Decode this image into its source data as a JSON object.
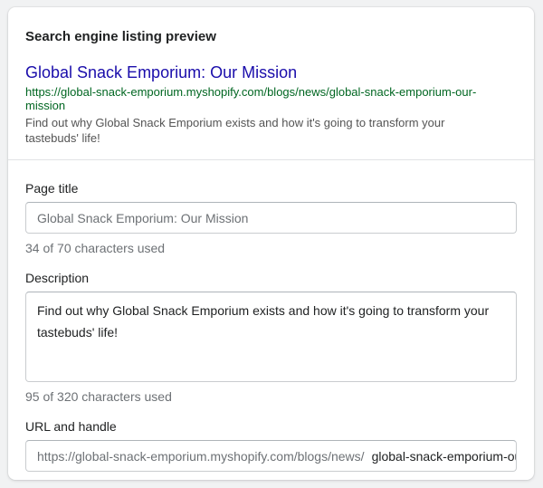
{
  "preview": {
    "heading": "Search engine listing preview",
    "title": "Global Snack Emporium: Our Mission",
    "url": "https://global-snack-emporium.myshopify.com/blogs/news/global-snack-emporium-our-mission",
    "description": "Find out why Global Snack Emporium exists and how it's going to transform your tastebuds' life!"
  },
  "page_title": {
    "label": "Page title",
    "value": "Global Snack Emporium: Our Mission",
    "help": "34 of 70 characters used"
  },
  "description": {
    "label": "Description",
    "value": "Find out why Global Snack Emporium exists and how it's going to transform your tastebuds' life!",
    "help": "95 of 320 characters used"
  },
  "url_handle": {
    "label": "URL and handle",
    "prefix": "https://global-snack-emporium.myshopify.com/blogs/news/",
    "handle": "global-snack-emporium-our-mission"
  }
}
